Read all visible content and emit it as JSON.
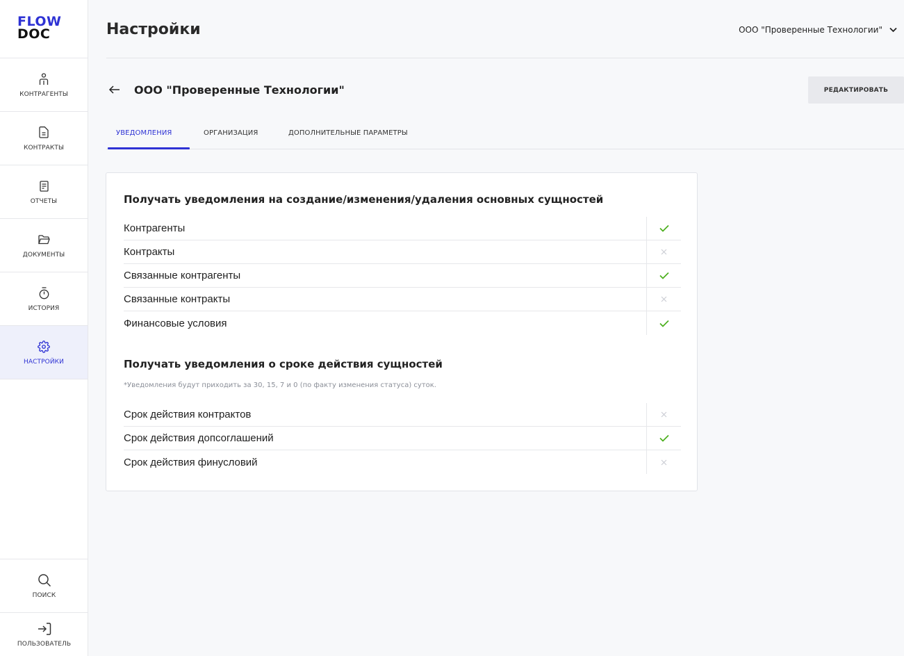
{
  "logo": {
    "line1": "FLOW",
    "line2": "DOC"
  },
  "sidebar": {
    "items": [
      {
        "label": "КОНТРАГЕНТЫ",
        "icon": "person-icon"
      },
      {
        "label": "КОНТРАКТЫ",
        "icon": "document-icon"
      },
      {
        "label": "ОТЧЕТЫ",
        "icon": "report-icon"
      },
      {
        "label": "ДОКУМЕНТЫ",
        "icon": "folder-icon"
      },
      {
        "label": "ИСТОРИЯ",
        "icon": "stopwatch-icon"
      },
      {
        "label": "НАСТРОЙКИ",
        "icon": "gear-icon",
        "active": true
      }
    ],
    "bottom": [
      {
        "label": "ПОИСК",
        "icon": "search-icon"
      },
      {
        "label": "ПОЛЬЗОВАТЕЛЬ",
        "icon": "login-icon"
      }
    ]
  },
  "header": {
    "title": "Настройки",
    "org_selector": "ООО \"Проверенные Технологии\""
  },
  "subheader": {
    "org_name": "ООО \"Проверенные Технологии\"",
    "edit_label": "РЕДАКТИРОВАТЬ"
  },
  "tabs": [
    {
      "label": "УВЕДОМЛЕНИЯ",
      "active": true
    },
    {
      "label": "ОРГАНИЗАЦИЯ"
    },
    {
      "label": "ДОПОЛНИТЕЛЬНЫЕ ПАРАМЕТРЫ"
    }
  ],
  "colors": {
    "accent": "#2e32d4",
    "check": "#4caf1e",
    "cross": "#c9ccd3"
  },
  "sections": [
    {
      "title": "Получать уведомления на создание/изменения/удаления основных сущностей",
      "rows": [
        {
          "label": "Контрагенты",
          "enabled": true
        },
        {
          "label": "Контракты",
          "enabled": false
        },
        {
          "label": "Связанные контрагенты",
          "enabled": true
        },
        {
          "label": "Связанные контракты",
          "enabled": false
        },
        {
          "label": "Финансовые условия",
          "enabled": true
        }
      ]
    },
    {
      "title": "Получать уведомления о сроке действия сущностей",
      "note": "*Уведомления будут приходить за 30, 15, 7 и 0 (по факту изменения статуса) суток.",
      "rows": [
        {
          "label": "Срок действия контрактов",
          "enabled": false
        },
        {
          "label": "Срок действия допсоглашений",
          "enabled": true
        },
        {
          "label": "Срок действия финусловий",
          "enabled": false
        }
      ]
    }
  ]
}
